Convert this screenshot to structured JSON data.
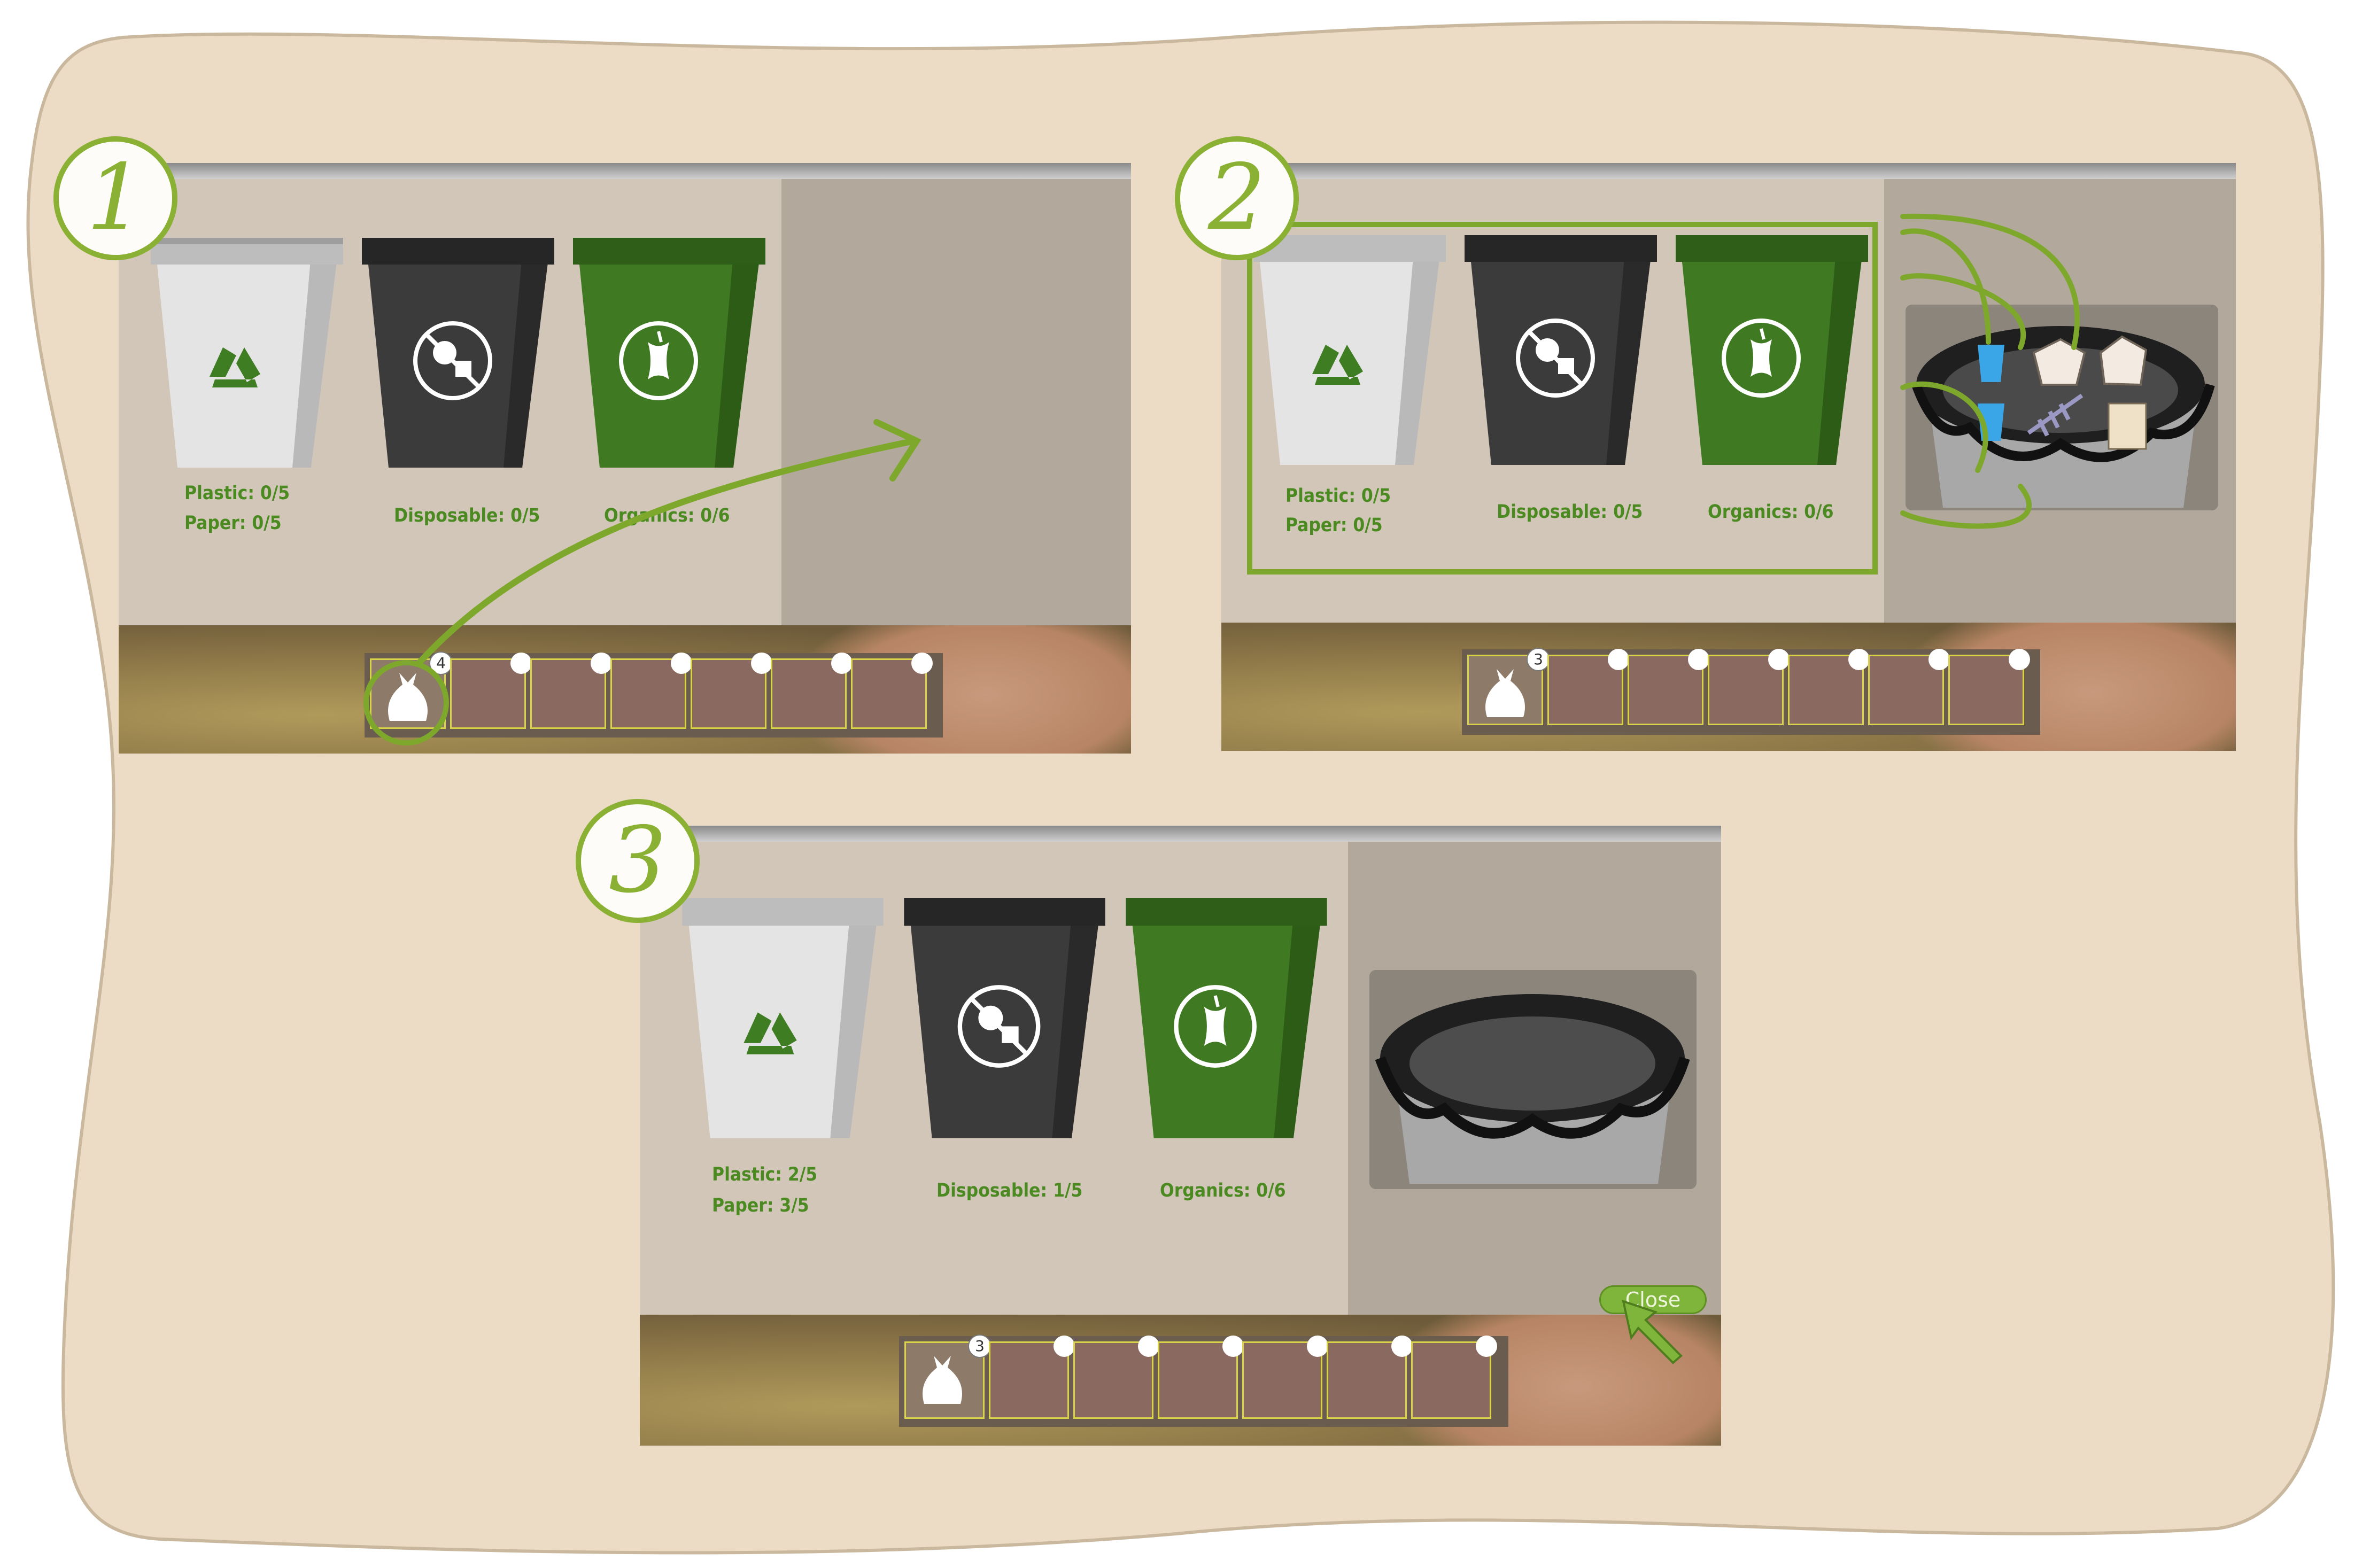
{
  "steps": [
    {
      "number": "1",
      "labels": {
        "plastic": "Plastic: 0/5",
        "paper": "Paper: 0/5",
        "disposable": "Disposable: 0/5",
        "organics": "Organics: 0/6"
      },
      "inventory": {
        "bag_count": "4",
        "slots": 7
      }
    },
    {
      "number": "2",
      "labels": {
        "plastic": "Plastic: 0/5",
        "paper": "Paper: 0/5",
        "disposable": "Disposable: 0/5",
        "organics": "Organics: 0/6"
      },
      "inventory": {
        "bag_count": "3",
        "slots": 7
      }
    },
    {
      "number": "3",
      "labels": {
        "plastic": "Plastic: 2/5",
        "paper": "Paper: 3/5",
        "disposable": "Disposable: 1/5",
        "organics": "Organics: 0/6"
      },
      "inventory": {
        "bag_count": "3",
        "slots": 7
      },
      "close_label": "Close"
    }
  ],
  "bins": [
    {
      "kind": "recycle",
      "icon": "recycle-icon",
      "color": "#e4e4e4",
      "lid": "#bdbdbd",
      "emblem": "#3f7d23"
    },
    {
      "kind": "disposable",
      "icon": "no-disposable-icon",
      "color": "#3b3b3b",
      "lid": "#262626",
      "emblem": "#ffffff"
    },
    {
      "kind": "organics",
      "icon": "apple-core-icon",
      "color": "#3f7a22",
      "lid": "#2f5e19",
      "emblem": "#ffffff"
    }
  ],
  "colors": {
    "accent": "#8ab034",
    "background": "#ecdcc5",
    "label_green": "#4b8a21"
  }
}
